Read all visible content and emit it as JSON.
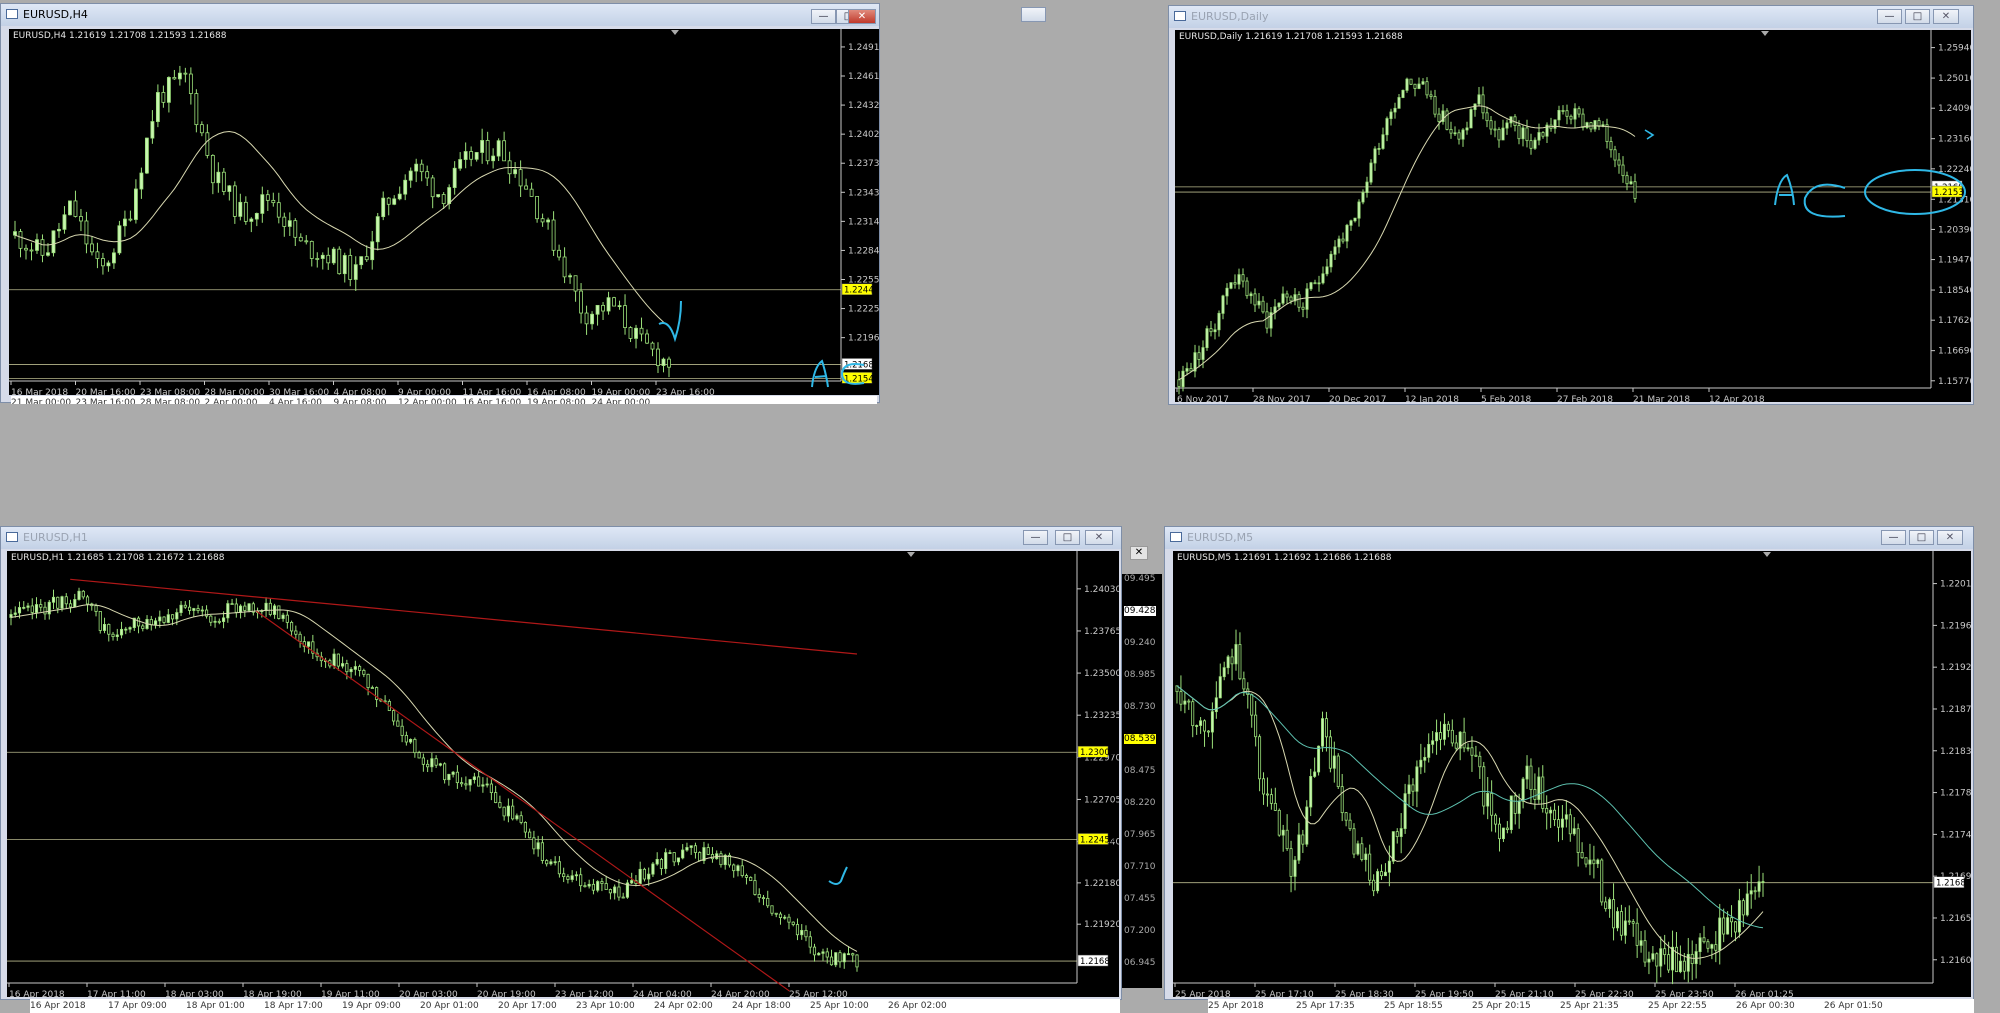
{
  "colors": {
    "background": "#000000",
    "candle": "#c8f5b0",
    "candle_outline": "#9be07a",
    "ma": "#d8d8b0",
    "ma_long": "#5ec2b0",
    "level_line": "#e6e6b0",
    "trend_line": "#b01818",
    "price_highlight": "#ffff00",
    "annotation": "#2fb8e6"
  },
  "windows": {
    "h4": {
      "title": "EURUSD,H4",
      "info": "EURUSD,H4  1.21619 1.21708 1.21593 1.21688",
      "min_icon": "minimize-icon",
      "max_icon": "maximize-icon",
      "close_icon": "close-icon",
      "price_ticks": [
        "1.24910",
        "1.24615",
        "1.24320",
        "1.24025",
        "1.23730",
        "1.23435",
        "1.23140",
        "1.22845",
        "1.22550",
        "1.22255",
        "1.21960"
      ],
      "time_ticks": [
        "16 Mar 2018",
        "20 Mar 16:00",
        "23 Mar 08:00",
        "28 Mar 00:00",
        "30 Mar 16:00",
        "4 Apr 08:00",
        "9 Apr 00:00",
        "11 Apr 16:00",
        "16 Apr 08:00",
        "19 Apr 00:00",
        "23 Apr 16:00"
      ],
      "ghost_ticks": [
        "21 Mar 00:00",
        "23 Mar 16:00",
        "28 Mar 08:00",
        "2 Apr 00:00",
        "4 Apr 16:00",
        "9 Apr 08:00",
        "12 Apr 00:00",
        "16 Apr 16:00",
        "19 Apr 08:00",
        "24 Apr 00:00"
      ],
      "labels": [
        {
          "text": "1.22446",
          "price": 1.22446,
          "hl": true
        },
        {
          "text": "1.21688",
          "price": 1.21688,
          "hl": false
        },
        {
          "text": "1.21547",
          "price": 1.21547,
          "hl": true
        }
      ],
      "annotation_text": "AC"
    },
    "daily": {
      "title": "EURUSD,Daily",
      "info": "EURUSD,Daily  1.21619 1.21708 1.21593 1.21688",
      "min_icon": "minimize-icon",
      "max_icon": "maximize-icon",
      "close_icon": "close-icon",
      "price_ticks": [
        "1.25940",
        "1.25010",
        "1.24090",
        "1.23160",
        "1.22240",
        "1.21310",
        "1.20390",
        "1.19470",
        "1.18540",
        "1.17620",
        "1.16690",
        "1.15770"
      ],
      "time_ticks": [
        "6 Nov 2017",
        "28 Nov 2017",
        "20 Dec 2017",
        "12 Jan 2018",
        "5 Feb 2018",
        "27 Feb 2018",
        "21 Mar 2018",
        "12 Apr 2018"
      ],
      "labels": [
        {
          "text": "1.21688",
          "price": 1.21688,
          "hl": false
        },
        {
          "text": "1.21531",
          "price": 1.21531,
          "hl": true
        }
      ],
      "annotation_text": "AC"
    },
    "h1": {
      "title": "EURUSD,H1",
      "info": "EURUSD,H1  1.21685 1.21708 1.21672 1.21688",
      "min_icon": "minimize-icon",
      "max_icon": "maximize-icon",
      "close_icon": "close-icon",
      "price_ticks": [
        "1.24030",
        "1.23765",
        "1.23500",
        "1.23235",
        "1.22970",
        "1.22705",
        "1.22440",
        "1.22180",
        "1.21920"
      ],
      "time_ticks": [
        "16 Apr 2018",
        "17 Apr 11:00",
        "18 Apr 03:00",
        "18 Apr 19:00",
        "19 Apr 11:00",
        "20 Apr 03:00",
        "20 Apr 19:00",
        "23 Apr 12:00",
        "24 Apr 04:00",
        "24 Apr 20:00",
        "25 Apr 12:00"
      ],
      "ghost_ticks": [
        "16 Apr 2018",
        "17 Apr 09:00",
        "18 Apr 01:00",
        "18 Apr 17:00",
        "19 Apr 09:00",
        "20 Apr 01:00",
        "20 Apr 17:00",
        "23 Apr 10:00",
        "24 Apr 02:00",
        "24 Apr 18:00",
        "25 Apr 10:00",
        "26 Apr 02:00"
      ],
      "labels": [
        {
          "text": "1.23002",
          "price": 1.23002,
          "hl": true
        },
        {
          "text": "1.22453",
          "price": 1.22453,
          "hl": true
        },
        {
          "text": "1.21688",
          "price": 1.21688,
          "hl": false
        }
      ],
      "side_ticks": [
        "09.495",
        "09.428",
        "09.240",
        "08.985",
        "08.730",
        "08.539",
        "08.475",
        "08.220",
        "07.965",
        "07.710",
        "07.455",
        "07.200",
        "06.945"
      ]
    },
    "m5": {
      "title": "EURUSD,M5",
      "info": "EURUSD,M5  1.21691 1.21692 1.21686 1.21688",
      "min_icon": "minimize-icon",
      "max_icon": "maximize-icon",
      "close_icon": "close-icon",
      "price_ticks": [
        "1.22010",
        "1.21965",
        "1.21920",
        "1.21875",
        "1.21830",
        "1.21785",
        "1.21740",
        "1.21695",
        "1.21650",
        "1.21605"
      ],
      "time_ticks": [
        "25 Apr 2018",
        "25 Apr 17:10",
        "25 Apr 18:30",
        "25 Apr 19:50",
        "25 Apr 21:10",
        "25 Apr 22:30",
        "25 Apr 23:50",
        "26 Apr 01:25"
      ],
      "ghost_ticks": [
        "25 Apr 2018",
        "25 Apr 17:35",
        "25 Apr 18:55",
        "25 Apr 20:15",
        "25 Apr 21:35",
        "25 Apr 22:55",
        "26 Apr 00:30",
        "26 Apr 01:50"
      ],
      "labels": [
        {
          "text": "1.21688",
          "price": 1.21688,
          "hl": false
        }
      ]
    }
  }
}
